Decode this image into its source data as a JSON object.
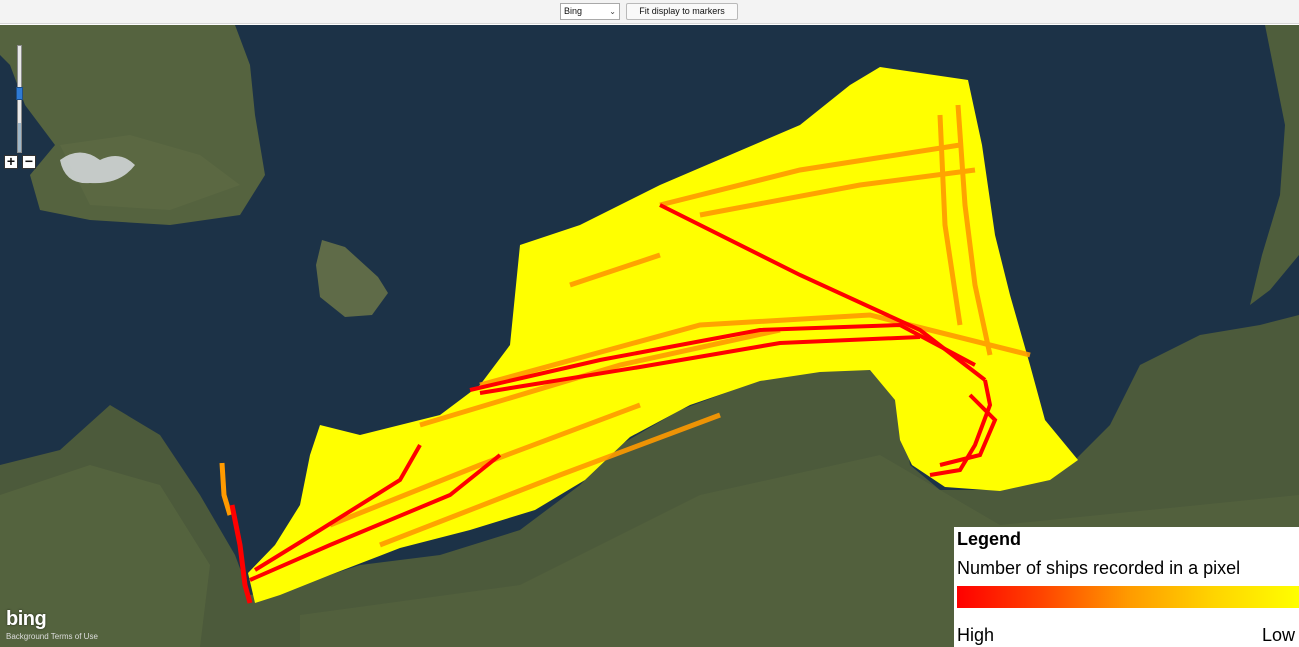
{
  "toolbar": {
    "provider_select_value": "Bing",
    "fit_button_label": "Fit display to markers"
  },
  "map": {
    "provider_logo": "bing",
    "attribution": "Background Terms of Use",
    "zoom_in_label": "+",
    "zoom_out_label": "−",
    "zoom_level_fraction": 0.27
  },
  "legend": {
    "title": "Legend",
    "subtitle": "Number of ships recorded in a pixel",
    "high_label": "High",
    "low_label": "Low",
    "gradient_colors": [
      "#ff0000",
      "#ff4500",
      "#ff9a00",
      "#ffd400",
      "#ffff00"
    ]
  },
  "colors": {
    "sea": "#1c3247",
    "land": "#4f5e3c",
    "density_low": "#ffff00",
    "density_mid": "#ff9a00",
    "density_high": "#ff0000"
  },
  "icons": {
    "zoom_in": "plus-icon",
    "zoom_out": "minus-icon",
    "select_chevron": "chevron-down-icon"
  }
}
